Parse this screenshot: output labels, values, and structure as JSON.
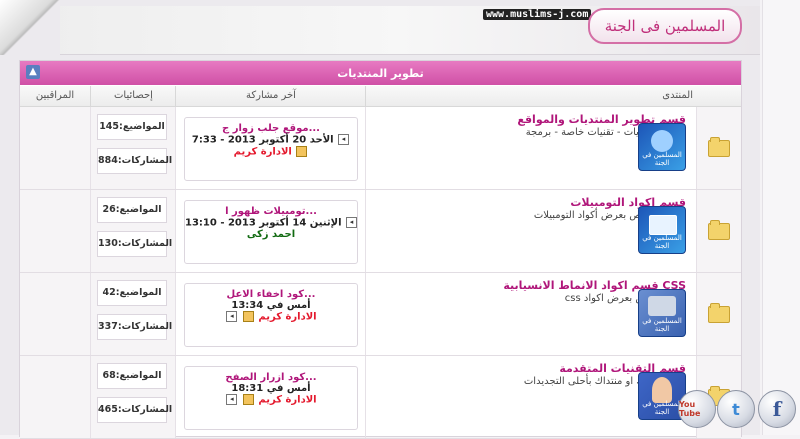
{
  "header": {
    "site_url": "www.muslims-j.com",
    "logo_text": "المسلمين فى الجنة"
  },
  "category": {
    "title": "تطوير المنتديات"
  },
  "columns": {
    "forum": "المنتدى",
    "last_post": "آخر مشاركة",
    "stats": "إحصائيات",
    "moderators": "المراقبين"
  },
  "forums": [
    {
      "title": "قسم تطوير المنتديات والمواقع",
      "description": "أتطوير منتديات - تقنيات خاصة - برمجة",
      "thumb_label": "المسلمين في الجنة",
      "last_post": {
        "topic": "موقع جلب زوار ج...",
        "date": "الأحد 20 أكتوبر 2013 - 7:33",
        "user": "الادارة كريم"
      },
      "topics": "المواضيع:145",
      "posts": "المشاركات:884"
    },
    {
      "title": "قسم اكواد التومبيلات",
      "description": "القسم مختص بعرض أكواد التومبيلات",
      "thumb_label": "المسلمين في الجنة",
      "last_post": {
        "topic": "تومبيلات ظهور ا...",
        "date": "الإثنين 14 أكتوبر 2013 - 13:10",
        "user": "احمد زكى"
      },
      "topics": "المواضيع:26",
      "posts": "المشاركات:130"
    },
    {
      "title": "قسم اكواد الانماط الانسيابية CSS",
      "description": "css قسم مختص بعرض اكواد",
      "thumb_label": "المسلمين في الجنة",
      "last_post": {
        "topic": "كود اخفاء الاعل...",
        "date": "أمس في 13:34",
        "user": "الادارة كريم"
      },
      "topics": "المواضيع:42",
      "posts": "المشاركات:337"
    },
    {
      "title": "قسم التقنيات المتقدمة",
      "description": "طور موقعك او منتداك بأحلى التجديدات",
      "thumb_label": "المسلمين في الجنة",
      "last_post": {
        "topic": "كود ازرار الصفح...",
        "date": "أمس في 18:31",
        "user": "الادارة كريم"
      },
      "topics": "المواضيع:68",
      "posts": "المشاركات:465"
    }
  ],
  "social": {
    "youtube": "You Tube",
    "twitter": "t",
    "facebook": "f"
  }
}
